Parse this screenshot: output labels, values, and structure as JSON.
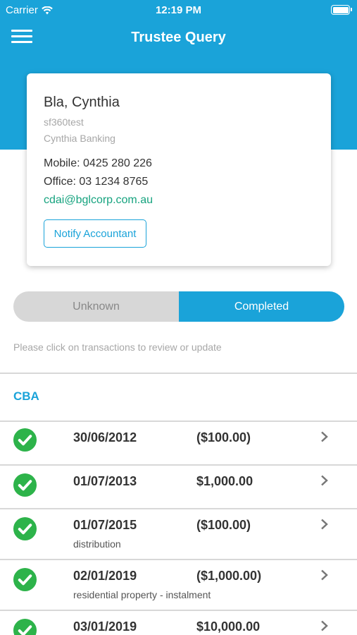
{
  "status_bar": {
    "carrier": "Carrier",
    "time": "12:19 PM"
  },
  "nav": {
    "title": "Trustee Query",
    "menu_icon": "hamburger-menu-icon"
  },
  "contact": {
    "name": "Bla, Cynthia",
    "username": "sf360test",
    "bank": "Cynthia Banking",
    "mobile": "Mobile: 0425 280 226",
    "office": "Office: 03 1234 8765",
    "email": "cdai@bglcorp.com.au",
    "notify_label": "Notify Accountant"
  },
  "segments": [
    {
      "label": "Unknown",
      "selected": false
    },
    {
      "label": "Completed",
      "selected": true
    }
  ],
  "hint": "Please click on transactions to review or update",
  "section_title": "CBA",
  "transactions": [
    {
      "date": "30/06/2012",
      "amount": "($100.00)",
      "description": ""
    },
    {
      "date": "01/07/2013",
      "amount": "$1,000.00",
      "description": ""
    },
    {
      "date": "01/07/2015",
      "amount": "($100.00)",
      "description": "distribution"
    },
    {
      "date": "02/01/2019",
      "amount": "($1,000.00)",
      "description": "residential property - instalment"
    },
    {
      "date": "03/01/2019",
      "amount": "$10,000.00",
      "description": ""
    }
  ],
  "colors": {
    "primary": "#1aa3d9",
    "check": "#2db34a",
    "email": "#16a37f"
  }
}
